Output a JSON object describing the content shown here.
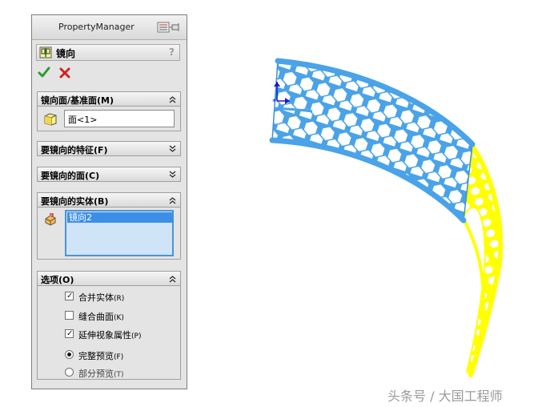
{
  "property_manager": {
    "title": "PropertyManager",
    "feature_name": "镜向",
    "help_label": "?",
    "sections": {
      "mirror_face": {
        "label": "镜向面/基准面(M)",
        "value": "面<1>"
      },
      "features": {
        "label": "要镜向的特征(F)"
      },
      "faces": {
        "label": "要镜向的面(C)"
      },
      "bodies": {
        "label": "要镜向的实体(B)",
        "items": [
          "镜向2"
        ]
      },
      "options": {
        "label": "选项(O)",
        "merge_solids": {
          "label": "合并实体",
          "key": "(R)",
          "checked": true
        },
        "knit_surfaces": {
          "label": "缝合曲面",
          "key": "(K)",
          "checked": false
        },
        "propagate_visual": {
          "label": "延伸视象属性",
          "key": "(P)",
          "checked": true
        },
        "full_preview": {
          "label": "完整预览",
          "key": "(F)",
          "selected": true
        },
        "partial_preview": {
          "label": "部分预览",
          "key": "(T)",
          "selected": false
        }
      }
    }
  },
  "watermark": "头条号 / 大国工程师",
  "colors": {
    "original_body": "#4aa3e8",
    "mirrored_body": "#ffff00",
    "selection": "#3c8fe6"
  }
}
